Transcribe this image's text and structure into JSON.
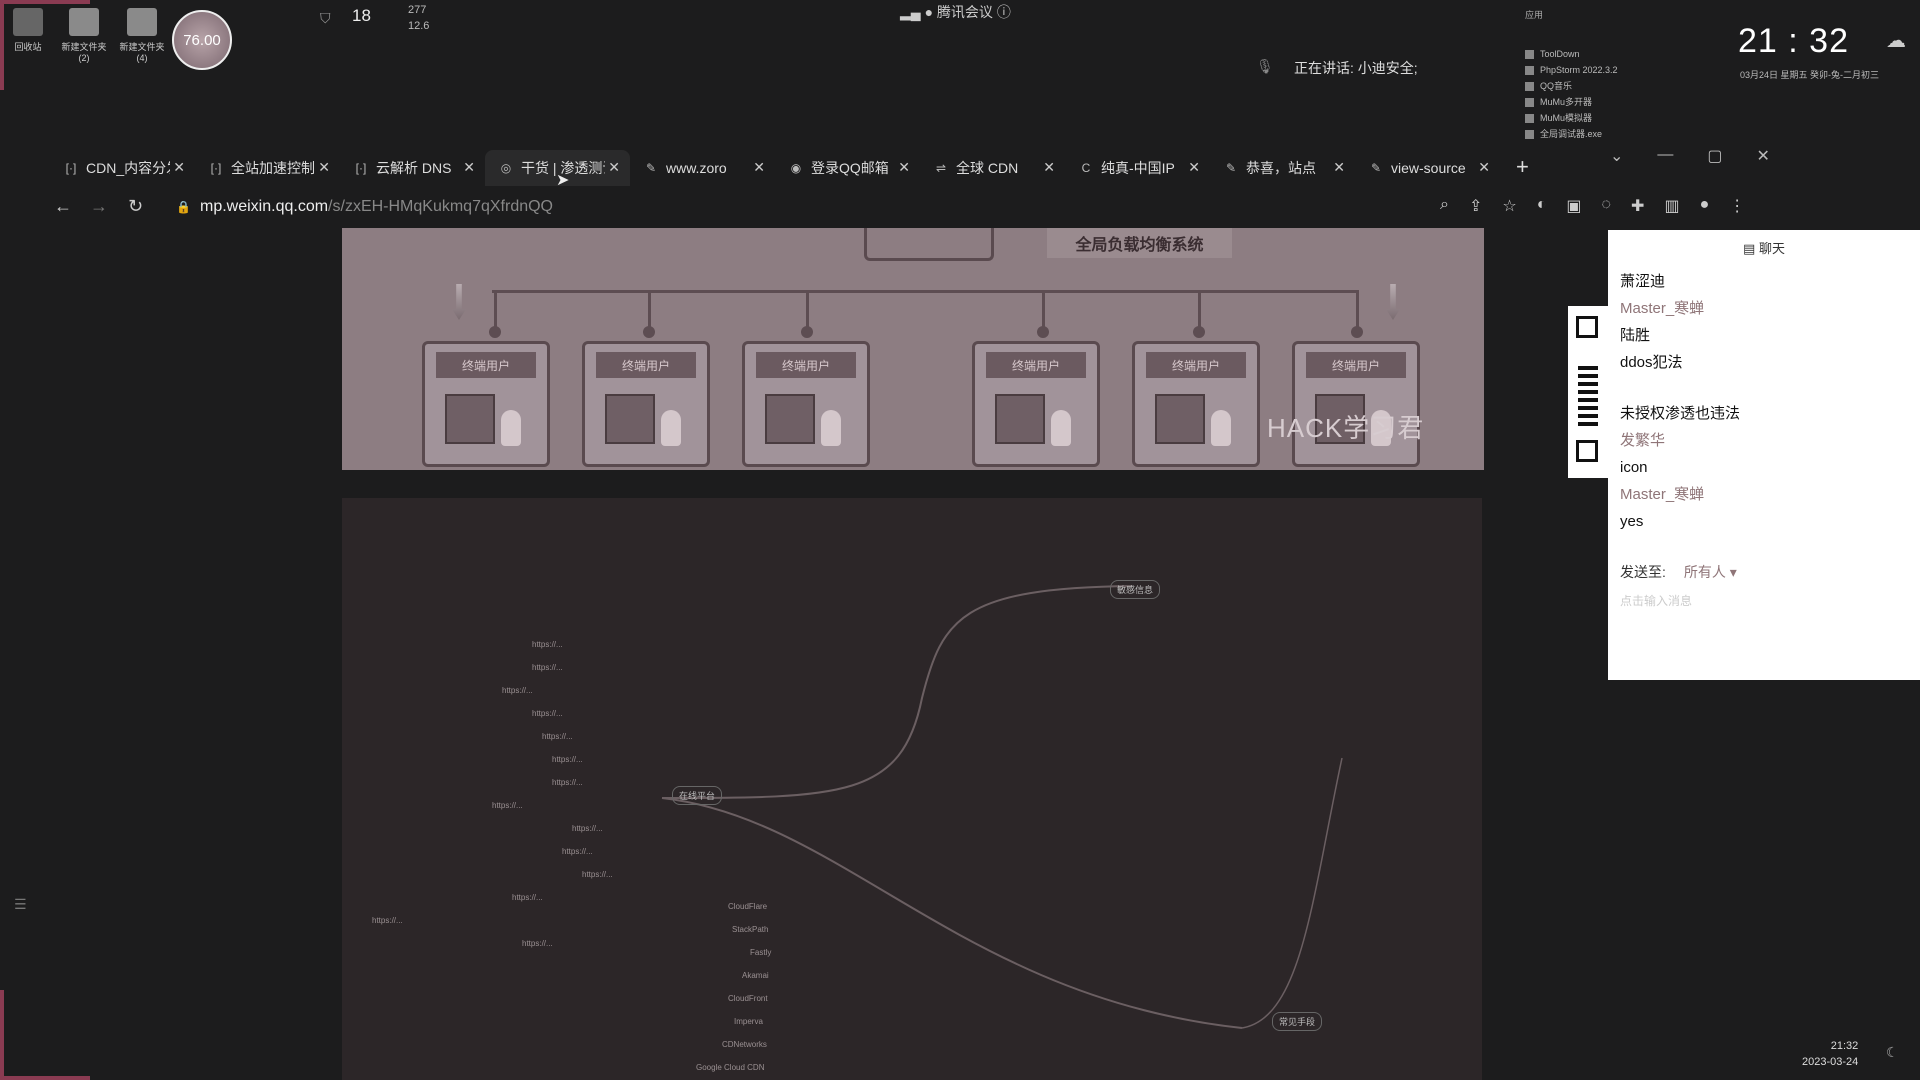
{
  "desktop": {
    "icons": [
      {
        "label": "回收站"
      },
      {
        "label": "新建文件夹 (2)"
      },
      {
        "label": "新建文件夹 (4)"
      }
    ],
    "perf_badge": "76.00",
    "shield_value": "18",
    "net_up": "277",
    "net_down": "12.6",
    "meeting_title": "腾讯会议",
    "speaking": "正在讲话: 小迪安全;",
    "clock_time": "21 : 32",
    "clock_date": "03月24日  星期五  癸卯-兔-二月初三",
    "tray_header": "应用",
    "tray_items": [
      "ToolDown",
      "PhpStorm 2022.3.2",
      "QQ音乐",
      "MuMu多开器",
      "MuMu模拟器",
      "全局调试器.exe"
    ],
    "bottom_time": "21:32",
    "bottom_date": "2023-03-24"
  },
  "browser": {
    "tabs": [
      {
        "icon": "[·]",
        "label": "CDN_内容分发"
      },
      {
        "icon": "[·]",
        "label": "全站加速控制"
      },
      {
        "icon": "[·]",
        "label": "云解析 DNS"
      },
      {
        "icon": "◎",
        "label": "干货 | 渗透测试",
        "active": true
      },
      {
        "icon": "✎",
        "label": "www.zoro"
      },
      {
        "icon": "◉",
        "label": "登录QQ邮箱"
      },
      {
        "icon": "⇌",
        "label": "全球 CDN"
      },
      {
        "icon": "C",
        "label": "纯真-中国IP"
      },
      {
        "icon": "✎",
        "label": "恭喜，站点"
      },
      {
        "icon": "✎",
        "label": "view-source"
      }
    ],
    "new_tab": "+",
    "url_host": "mp.weixin.qq.com",
    "url_path": "/s/zxEH-HMqKukmq7qXfrdnQQ"
  },
  "article": {
    "diagram_title": "全局负载均衡系统",
    "node_label": "终端用户",
    "watermark": "HACK学习君",
    "mindmap_hubs": [
      "敏感信息",
      "在线平台",
      "常见手段"
    ],
    "mindmap_left": [
      "https://...",
      "https://...",
      "https://...",
      "https://...",
      "https://...",
      "https://...",
      "https://...",
      "https://...",
      "https://...",
      "https://...",
      "https://...",
      "https://...",
      "https://...",
      "https://..."
    ],
    "mindmap_cdn": [
      "CloudFlare",
      "StackPath",
      "Fastly",
      "Akamai",
      "CloudFront",
      "Imperva",
      "CDNetworks",
      "Google Cloud CDN"
    ]
  },
  "chat": {
    "header": "聊天",
    "messages": [
      {
        "name": "萧涩迪",
        "text": ""
      },
      {
        "name": "Master_寒蝉",
        "text": "陆胜"
      },
      {
        "name": "",
        "text": "ddos犯法"
      },
      {
        "name": "",
        "text": ""
      },
      {
        "name": "",
        "text": "未授权渗透也违法"
      },
      {
        "name": "发繁华",
        "text": "icon"
      },
      {
        "name": "Master_寒蝉",
        "text": "yes"
      }
    ],
    "send_to_label": "发送至:",
    "send_to_value": "所有人 ▾",
    "placeholder": "点击输入消息"
  }
}
